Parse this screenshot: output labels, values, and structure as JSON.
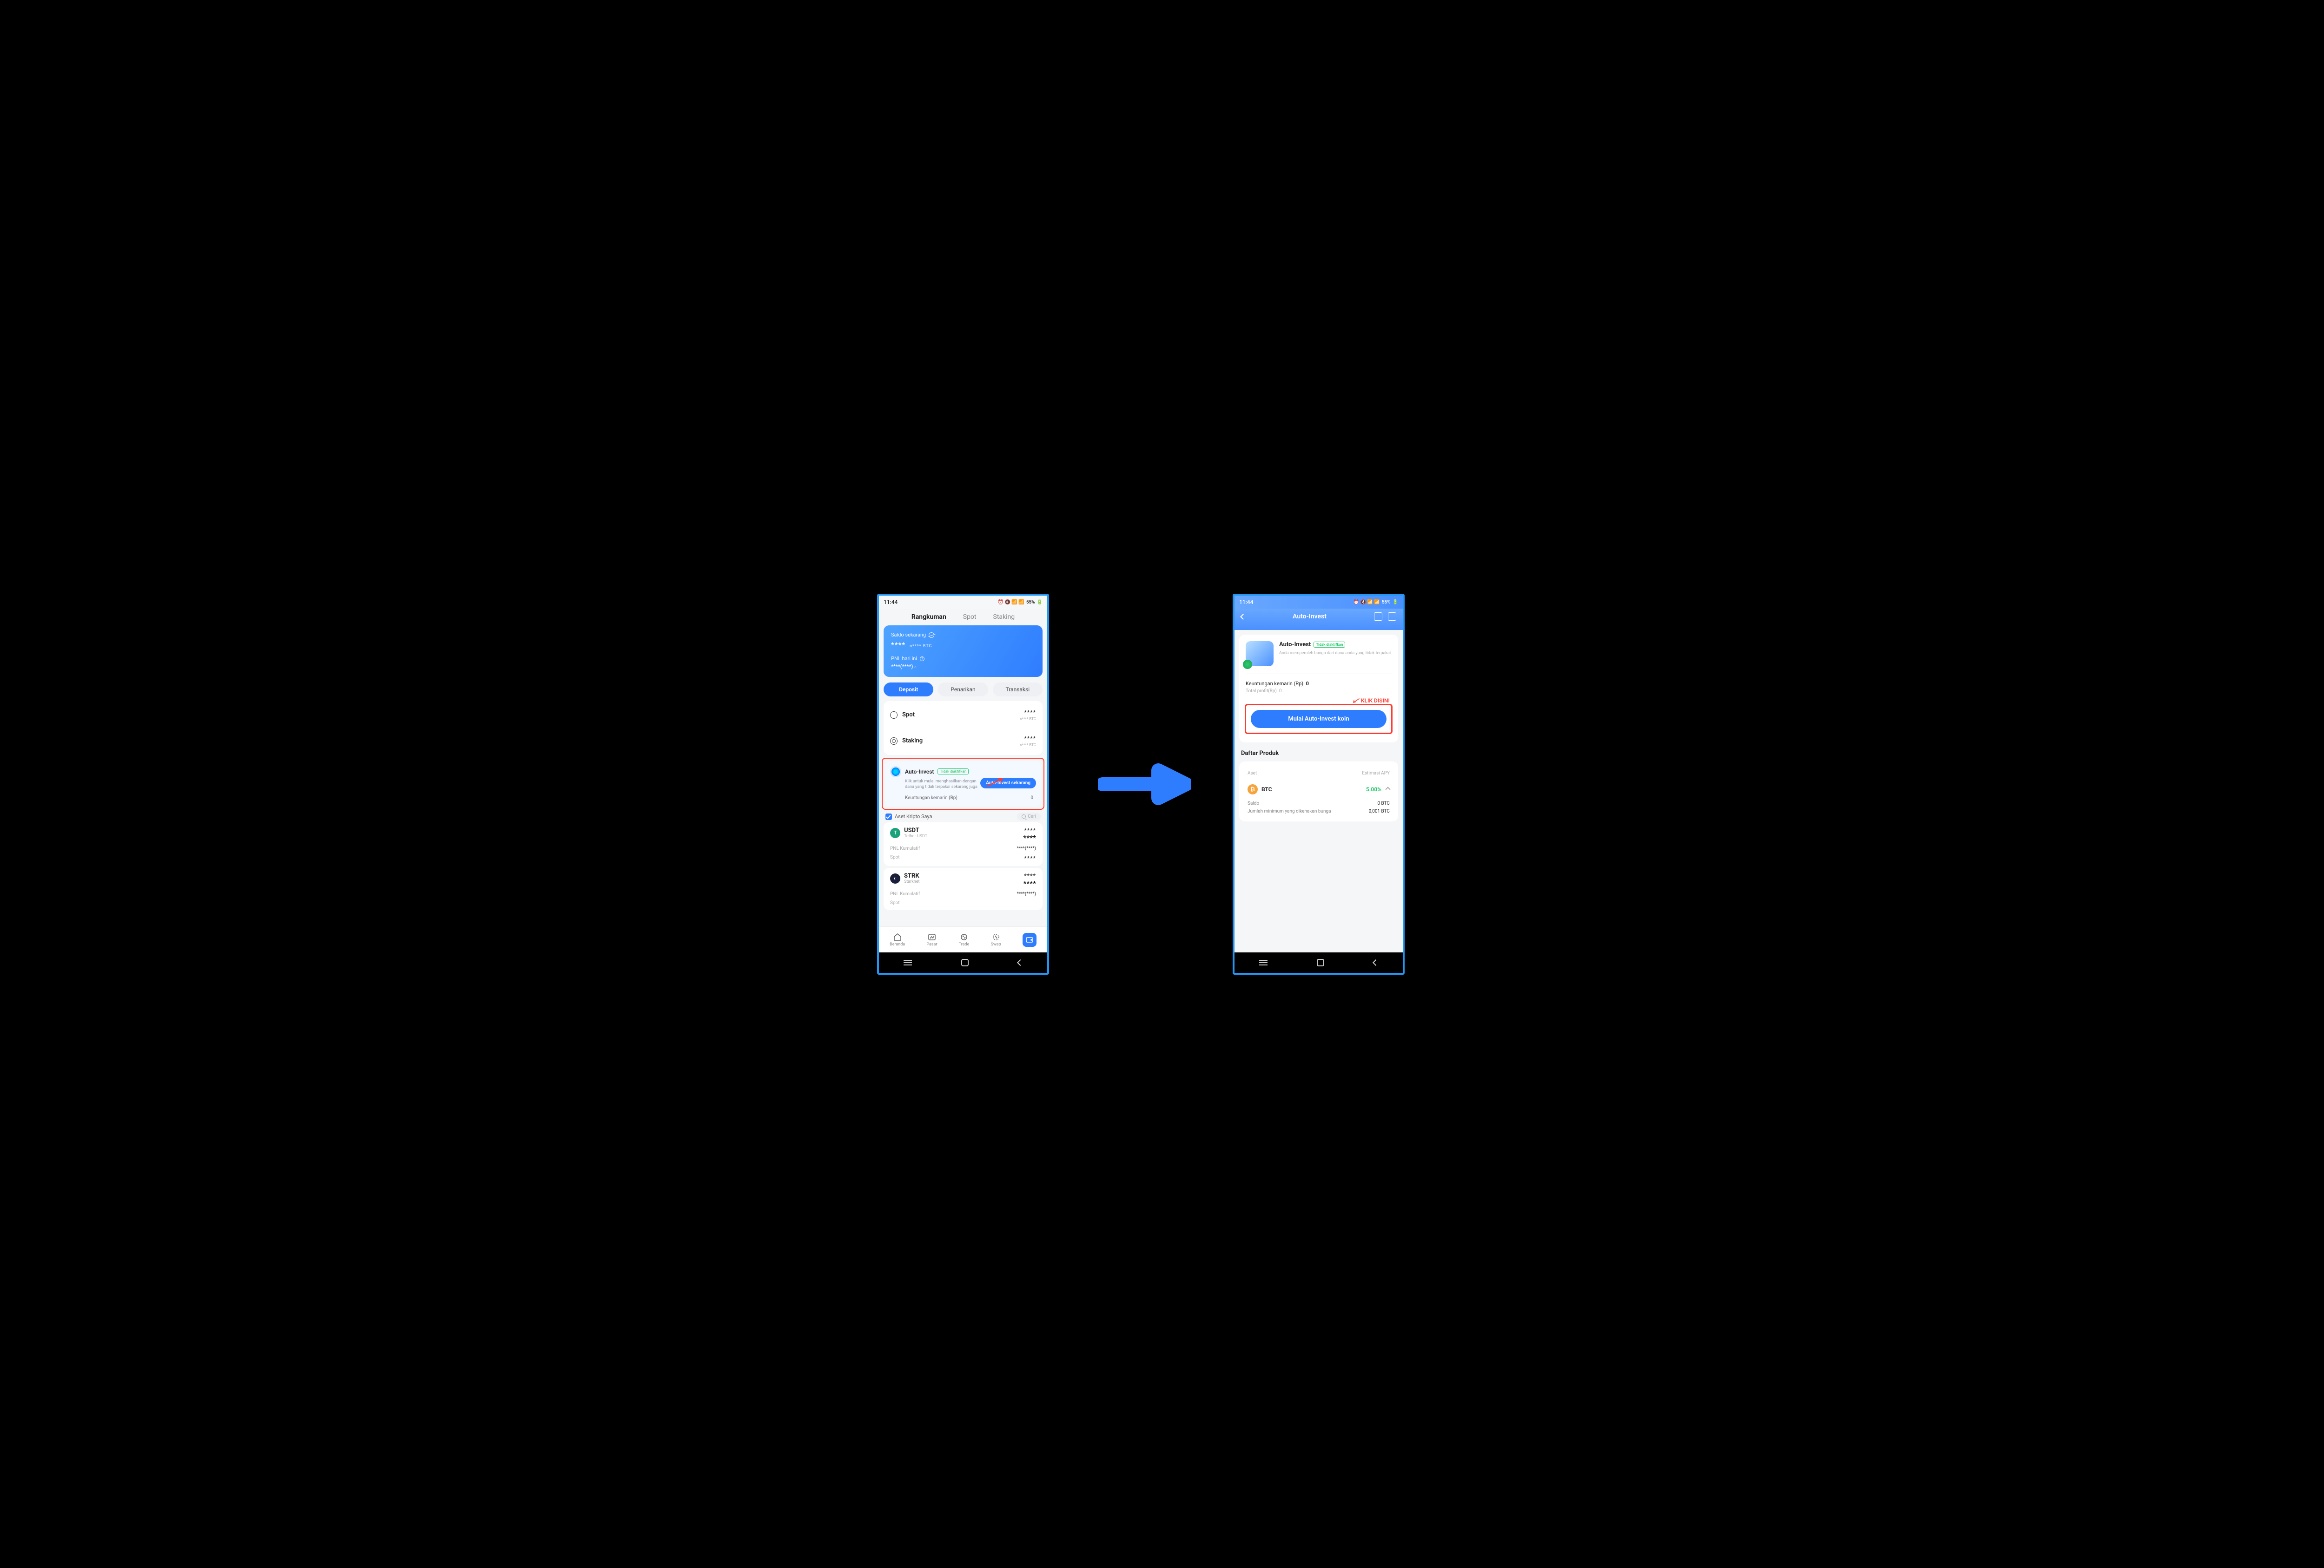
{
  "status": {
    "time": "11:44",
    "battery": "55%"
  },
  "tabs": {
    "t1": "Rangkuman",
    "t2": "Spot",
    "t3": "Staking"
  },
  "balance": {
    "label": "Saldo sekarang",
    "amount": "****",
    "unit": "≈**** BTC",
    "pnl_label": "PNL hari ini",
    "pnl_value": "****(****) ›"
  },
  "actions": {
    "deposit": "Deposit",
    "withdraw": "Penarikan",
    "tx": "Transaksi"
  },
  "rows": {
    "spot": {
      "name": "Spot",
      "val": "****",
      "sub": "≈**** BTC"
    },
    "staking": {
      "name": "Staking",
      "val": "****",
      "sub": "≈**** BTC"
    }
  },
  "ai": {
    "title": "Auto-Invest",
    "status": "Tidak diaktifkan",
    "desc": "Klik untuk mulai menghasilkan dengan dana yang tidak terpakai sekarang juga",
    "btn": "Auto-Invest sekarang",
    "profit_label": "Keuntungan kemarin (Rp)",
    "profit_val": "0"
  },
  "my_assets_label": "Aset Kripto Saya",
  "search_placeholder": "Cari",
  "assets": [
    {
      "sym": "USDT",
      "full": "Tether USDT",
      "color": "#1ba27a",
      "letter": "T",
      "pnl_label": "PNL Kumulatif",
      "pnl": "****(****)",
      "pnl_class": "red",
      "spot_label": "Spot",
      "spot_val": "****",
      "bal": "****",
      "bal2": "****"
    },
    {
      "sym": "STRK",
      "full": "Starknet",
      "color": "#1b1f3a",
      "letter": "◐",
      "pnl_label": "PNL Kumulatif",
      "pnl": "****(****)",
      "pnl_class": "",
      "spot_label": "Spot",
      "spot_val": "",
      "bal": "****",
      "bal2": "****"
    }
  ],
  "bnav": {
    "home": "Beranda",
    "market": "Pasar",
    "trade": "Trade",
    "swap": "Swap"
  },
  "r": {
    "header_title": "Auto-Invest",
    "card_title": "Auto-Invest",
    "card_status": "Tidak diaktifkan",
    "card_desc": "Anda memperoleh bunga dari dana anda yang tidak terpakai",
    "profit_yday_label": "Keuntungan kemarin (Rp)",
    "profit_yday_val": "0",
    "total_label": "Total profit(Rp)",
    "total_val": "0",
    "klik": "KLIK DISINI",
    "big_btn": "Mulai Auto-Invest koin",
    "list_title": "Daftar Produk",
    "col1": "Aset",
    "col2": "Estimasi APY",
    "asset_sym": "BTC",
    "asset_apy": "5.00%",
    "saldo_label": "Saldo",
    "saldo_val": "0 BTC",
    "min_label": "Jumlah minimum yang dikenakan bunga",
    "min_val": "0,001 BTC"
  }
}
